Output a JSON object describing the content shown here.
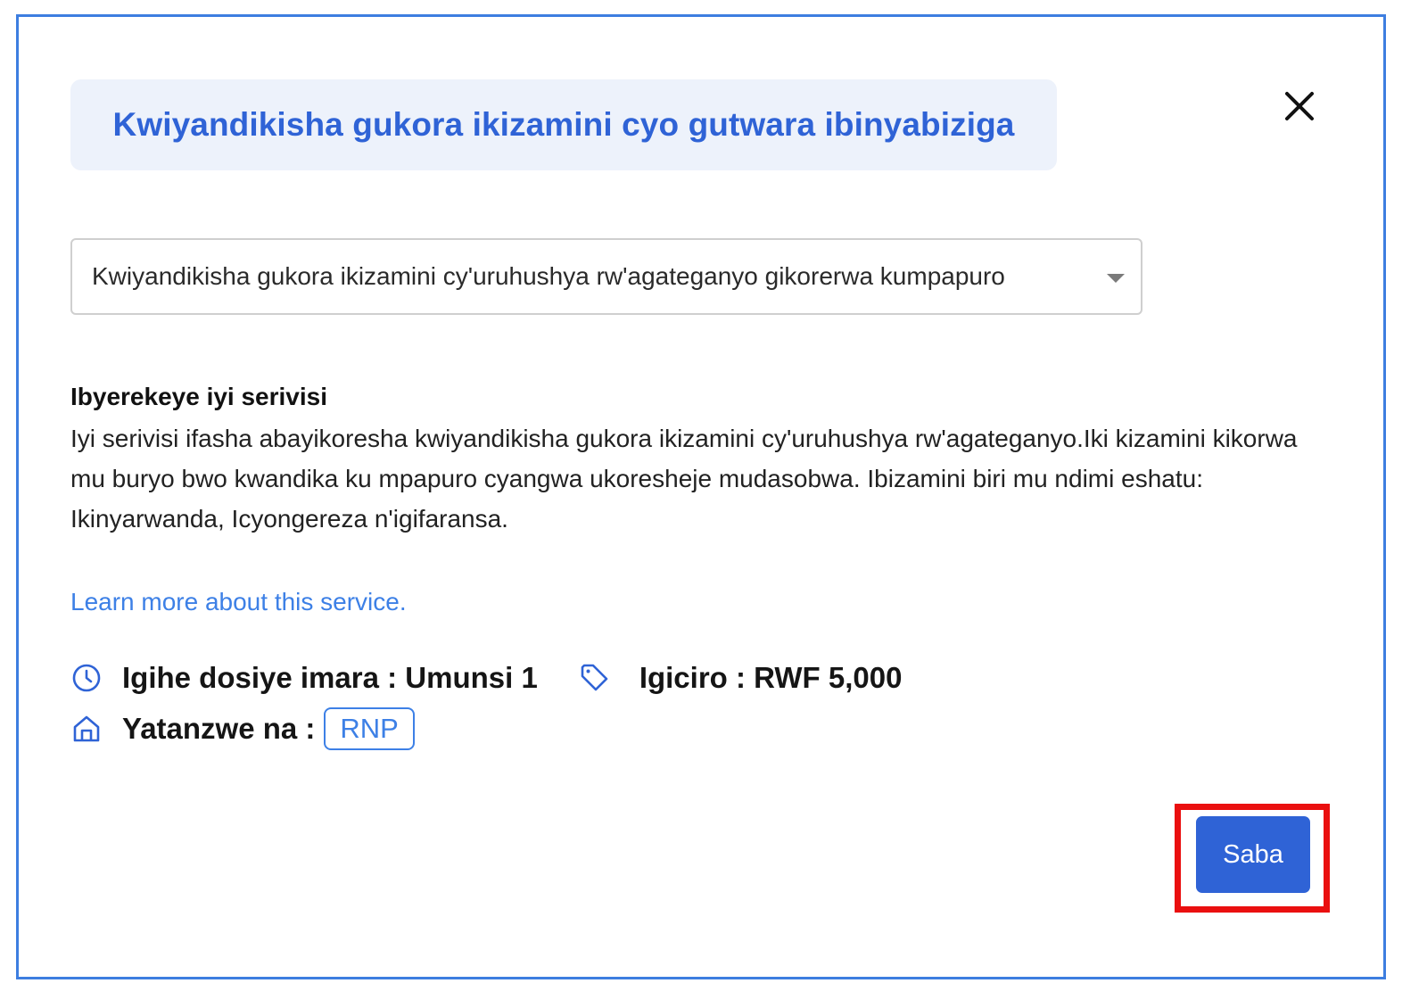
{
  "modal": {
    "title": "Kwiyandikisha gukora ikizamini cyo gutwara ibinyabiziga",
    "close_icon": "close-icon"
  },
  "service_select": {
    "selected": "Kwiyandikisha gukora ikizamini cy'uruhushya rw'agateganyo gikorerwa kumpapuro",
    "icon": "chevron-down-icon"
  },
  "about": {
    "heading": "Ibyerekeye iyi serivisi",
    "body": "Iyi serivisi ifasha abayikoresha kwiyandikisha gukora ikizamini cy'uruhushya rw'agateganyo.Iki kizamini kikorwa mu buryo bwo kwandika ku mpapuro cyangwa ukoresheje mudasobwa. Ibizamini biri mu ndimi eshatu: Ikinyarwanda, Icyongereza n'igifaransa."
  },
  "learn_more": "Learn more about this service.",
  "meta": {
    "processing_time": "Igihe dosiye imara : Umunsi 1",
    "price": "Igiciro : RWF 5,000",
    "provided_by_label": "Yatanzwe na :",
    "provider": "RNP",
    "icons": [
      "clock-icon",
      "tag-icon",
      "building-icon"
    ]
  },
  "actions": {
    "submit_label": "Saba"
  },
  "colors": {
    "accent": "#2f63d6",
    "link": "#3d80e6",
    "modal_border": "#3d7ee0",
    "highlight": "#ea0f0f",
    "title_bg": "#edf2fb"
  }
}
